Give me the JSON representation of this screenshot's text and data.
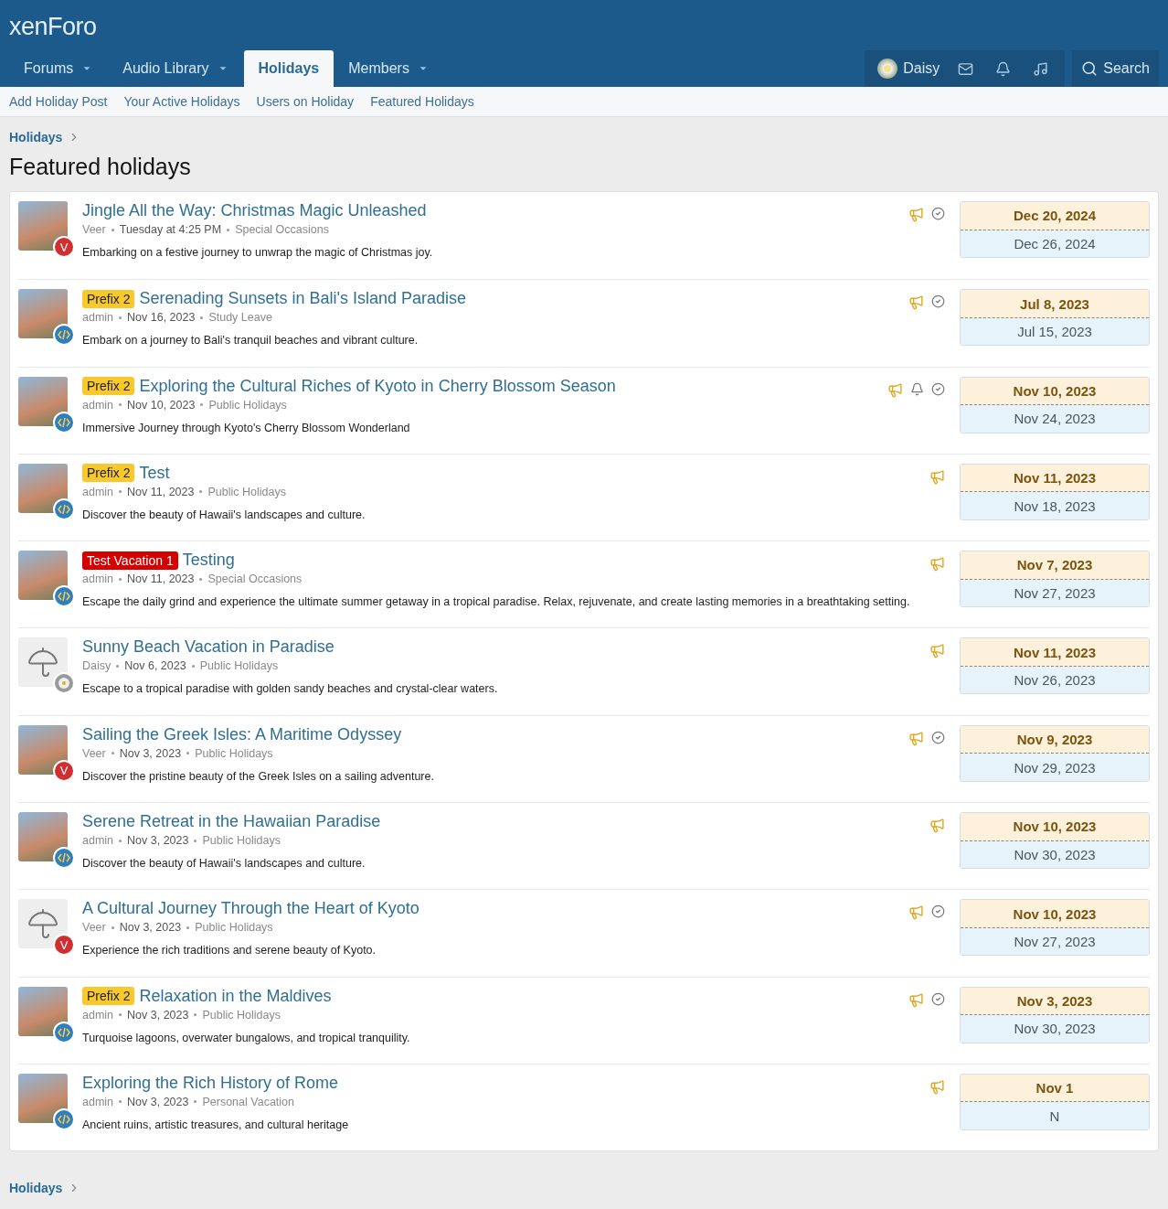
{
  "header": {
    "logo": "xenForo",
    "tabs": [
      {
        "label": "Forums",
        "selected": false,
        "dropdown": true
      },
      {
        "label": "Audio Library",
        "selected": false,
        "dropdown": true
      },
      {
        "label": "Holidays",
        "selected": true,
        "dropdown": false
      },
      {
        "label": "Members",
        "selected": false,
        "dropdown": true
      }
    ],
    "user": "Daisy",
    "search": "Search"
  },
  "subnav": [
    "Add Holiday Post",
    "Your Active Holidays",
    "Users on Holiday",
    "Featured Holidays"
  ],
  "breadcrumb": "Holidays",
  "title": "Featured holidays",
  "items": [
    {
      "title": "Jingle All the Way: Christmas Magic Unleashed",
      "author": "Veer",
      "date": "Tuesday at 4:25 PM",
      "category": "Special Occasions",
      "snippet": "Embarking on a festive journey to unwrap the magic of Christmas joy.",
      "start": "Dec 20, 2024",
      "end": "Dec 26, 2024",
      "photo": true,
      "badge": {
        "kind": "letter",
        "text": "V"
      },
      "featured": true,
      "bell": false,
      "check": true
    },
    {
      "prefix": {
        "label": "Prefix 2",
        "kind": "yellow"
      },
      "title": "Serenading Sunsets in Bali's Island Paradise",
      "author": "admin",
      "date": "Nov 16, 2023",
      "category": "Study Leave",
      "snippet": "Embark on a journey to Bali's tranquil beaches and vibrant culture.",
      "start": "Jul 8, 2023",
      "end": "Jul 15, 2023",
      "photo": true,
      "badge": {
        "kind": "code"
      },
      "featured": true,
      "bell": false,
      "check": true
    },
    {
      "prefix": {
        "label": "Prefix 2",
        "kind": "yellow"
      },
      "title": "Exploring the Cultural Riches of Kyoto in Cherry Blossom Season",
      "author": "admin",
      "date": "Nov 10, 2023",
      "category": "Public Holidays",
      "snippet": "Immersive Journey through Kyoto's Cherry Blossom Wonderland",
      "start": "Nov 10, 2023",
      "end": "Nov 24, 2023",
      "photo": true,
      "badge": {
        "kind": "code"
      },
      "featured": true,
      "bell": true,
      "check": true
    },
    {
      "prefix": {
        "label": "Prefix 2",
        "kind": "yellow"
      },
      "title": "Test",
      "author": "admin",
      "date": "Nov 11, 2023",
      "category": "Public Holidays",
      "snippet": "Discover the beauty of Hawaii's landscapes and culture.",
      "start": "Nov 11, 2023",
      "end": "Nov 18, 2023",
      "photo": true,
      "badge": {
        "kind": "code"
      },
      "featured": true,
      "bell": false,
      "check": false
    },
    {
      "prefix": {
        "label": "Test Vacation 1",
        "kind": "red"
      },
      "title": "Testing",
      "author": "admin",
      "date": "Nov 11, 2023",
      "category": "Special Occasions",
      "snippet": "Escape the daily grind and experience the ultimate summer getaway in a tropical paradise. Relax, rejuvenate, and create lasting memories in a breathtaking setting.",
      "start": "Nov 7, 2023",
      "end": "Nov 27, 2023",
      "photo": true,
      "badge": {
        "kind": "code"
      },
      "featured": true,
      "bell": false,
      "check": false
    },
    {
      "title": "Sunny Beach Vacation in Paradise",
      "author": "Daisy",
      "date": "Nov 6, 2023",
      "category": "Public Holidays",
      "snippet": "Escape to a tropical paradise with golden sandy beaches and crystal-clear waters.",
      "start": "Nov 11, 2023",
      "end": "Nov 26, 2023",
      "photo": false,
      "badge": {
        "kind": "flower"
      },
      "featured": true,
      "bell": false,
      "check": false
    },
    {
      "title": "Sailing the Greek Isles: A Maritime Odyssey",
      "author": "Veer",
      "date": "Nov 3, 2023",
      "category": "Public Holidays",
      "snippet": "Discover the pristine beauty of the Greek Isles on a sailing adventure.",
      "start": "Nov 9, 2023",
      "end": "Nov 29, 2023",
      "photo": true,
      "badge": {
        "kind": "letter",
        "text": "V"
      },
      "featured": true,
      "bell": false,
      "check": true
    },
    {
      "title": "Serene Retreat in the Hawaiian Paradise",
      "author": "admin",
      "date": "Nov 3, 2023",
      "category": "Public Holidays",
      "snippet": "Discover the beauty of Hawaii's landscapes and culture.",
      "start": "Nov 10, 2023",
      "end": "Nov 30, 2023",
      "photo": true,
      "badge": {
        "kind": "code"
      },
      "featured": true,
      "bell": false,
      "check": false
    },
    {
      "title": "A Cultural Journey Through the Heart of Kyoto",
      "author": "Veer",
      "date": "Nov 3, 2023",
      "category": "Public Holidays",
      "snippet": "Experience the rich traditions and serene beauty of Kyoto.",
      "start": "Nov 10, 2023",
      "end": "Nov 27, 2023",
      "photo": false,
      "badge": {
        "kind": "letter",
        "text": "V"
      },
      "featured": true,
      "bell": false,
      "check": true
    },
    {
      "prefix": {
        "label": "Prefix 2",
        "kind": "yellow"
      },
      "title": "Relaxation in the Maldives",
      "author": "admin",
      "date": "Nov 3, 2023",
      "category": "Public Holidays",
      "snippet": "Turquoise lagoons, overwater bungalows, and tropical tranquility.",
      "start": "Nov 3, 2023",
      "end": "Nov 30, 2023",
      "photo": true,
      "badge": {
        "kind": "code"
      },
      "featured": true,
      "bell": false,
      "check": true
    },
    {
      "title": "Exploring the Rich History of Rome",
      "author": "admin",
      "date": "Nov 3, 2023",
      "category": "Personal Vacation",
      "snippet": "Ancient ruins, artistic treasures, and cultural heritage",
      "start": "Nov 1",
      "end": "N",
      "photo": true,
      "badge": {
        "kind": "code"
      },
      "featured": true,
      "bell": false,
      "check": false
    }
  ],
  "footer_breadcrumb": "Holidays"
}
